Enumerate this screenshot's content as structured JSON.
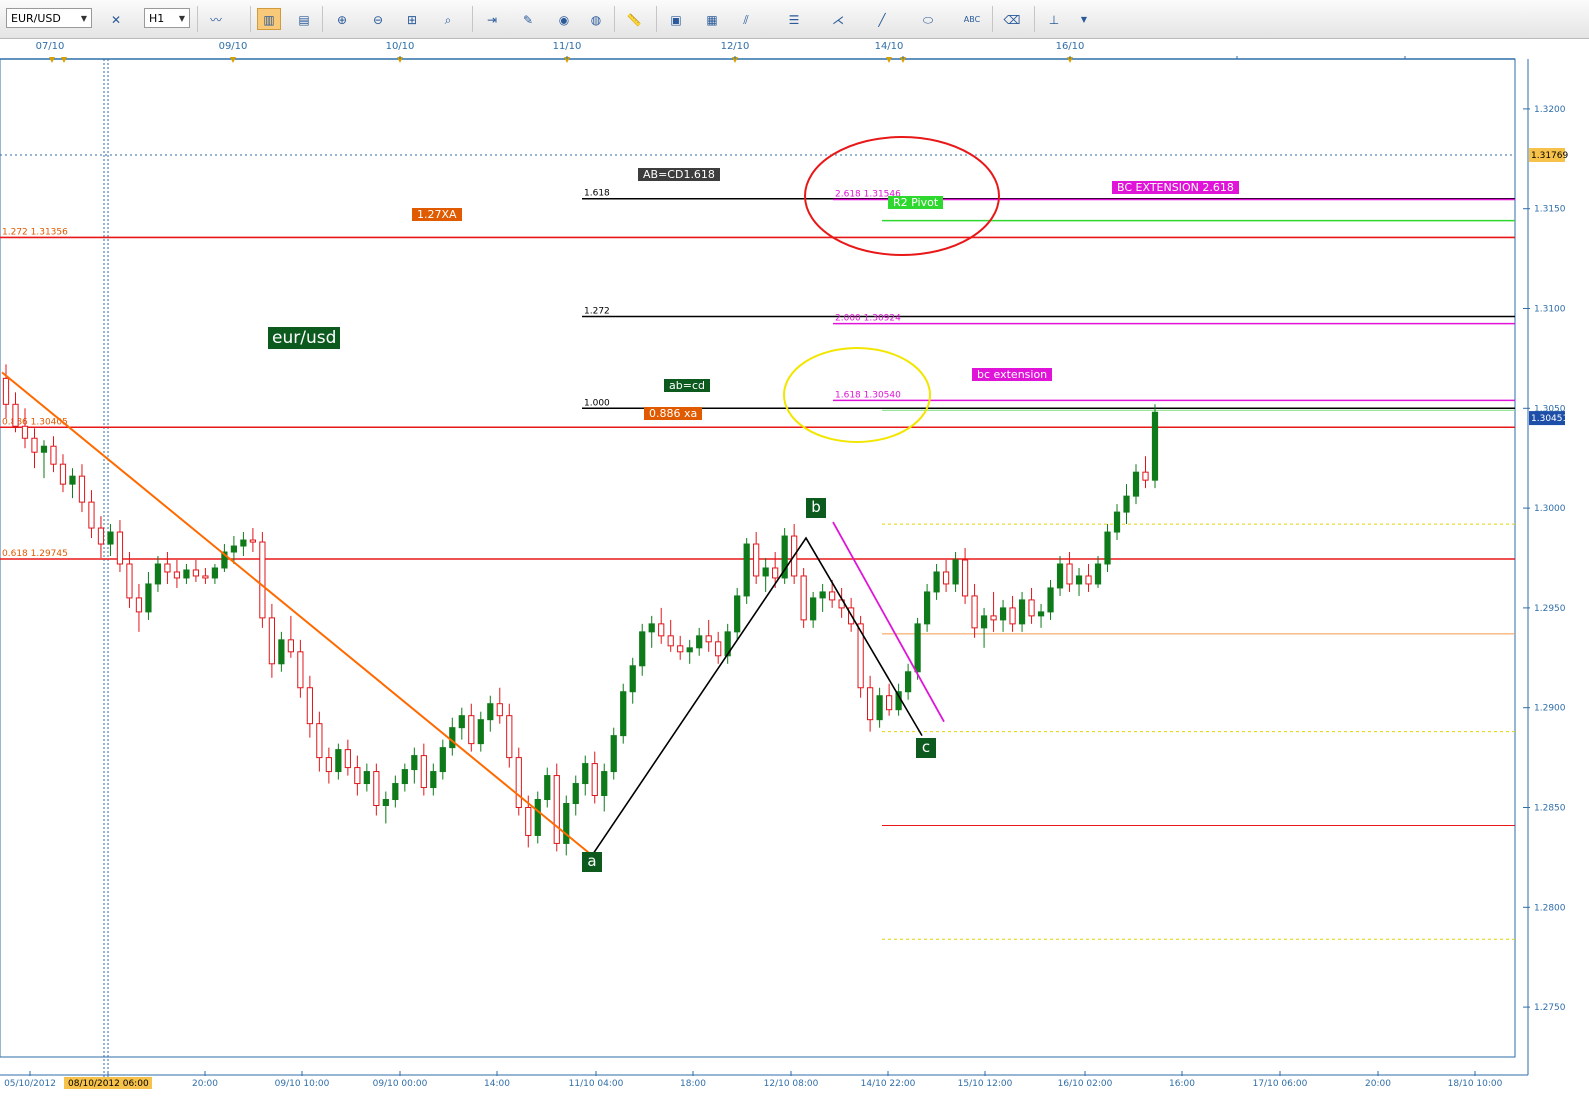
{
  "toolbar": {
    "symbol": "EUR/USD",
    "timeframe": "H1",
    "icons": [
      "chart-type-icon",
      "crosshair-icon",
      "bar-chart-icon",
      "candle-chart-icon",
      "indicator-icon",
      "zoom-in-icon",
      "zoom-out-icon",
      "zoom-fit-icon",
      "period-separator-icon",
      "template-icon",
      "trade-icon",
      "globe-icon",
      "ruler-icon",
      "picture-icon",
      "objects-icon",
      "trendline-icon",
      "hline-icon",
      "pitchfork-icon",
      "line-icon",
      "ellipse-icon",
      "text-icon",
      "eraser-icon",
      "tree-icon"
    ]
  },
  "date_axis": [
    "07/10",
    "09/10",
    "10/10",
    "11/10",
    "12/10",
    "14/10",
    "16/10"
  ],
  "time_axis": [
    "05/10/2012",
    "08/10/2012 06:00",
    "20:00",
    "09/10 10:00",
    "09/10 00:00",
    "14:00",
    "11/10 04:00",
    "18:00",
    "12/10 08:00",
    "14/10 22:00",
    "15/10 12:00",
    "16/10 02:00",
    "16:00",
    "17/10 06:00",
    "20:00",
    "18/10 10:00"
  ],
  "price_axis": [
    "1.3200",
    "1.3150",
    "1.3100",
    "1.3050",
    "1.3000",
    "1.2950",
    "1.2900",
    "1.2850",
    "1.2800",
    "1.2750"
  ],
  "price_markers": {
    "current": "1.30451",
    "dotted": "1.31769"
  },
  "colors": {
    "bull": "#0e7a1a",
    "bear": "#e0151a",
    "axis": "#2f6ea8",
    "fib": "#e05a00",
    "pink": "#e014d8"
  },
  "chart_data": {
    "type": "candlestick",
    "title": "eur/usd",
    "ylim": [
      1.2725,
      1.3225
    ],
    "levels": [
      {
        "price": 1.31769,
        "label": "",
        "style": "dotted-blue"
      },
      {
        "price": 1.3155,
        "label": "1.618",
        "box": "AB=CD1.618",
        "style": "black"
      },
      {
        "price": 1.31546,
        "label": "2.618 1.31546",
        "box": "BC EXTENSION 2.618",
        "style": "pink"
      },
      {
        "price": 1.3144,
        "label": "",
        "box": "R2 Pivot",
        "style": "green"
      },
      {
        "price": 1.31356,
        "label": "1.272 1.31356",
        "box": "1.27XA",
        "style": "red"
      },
      {
        "price": 1.3096,
        "label": "1.272",
        "style": "black"
      },
      {
        "price": 1.30924,
        "label": "2.000 1.30924",
        "style": "pink"
      },
      {
        "price": 1.3054,
        "label": "1.618 1.30540",
        "box": "bc extension",
        "style": "pink"
      },
      {
        "price": 1.305,
        "label": "1.000",
        "box": "ab=cd",
        "style": "black"
      },
      {
        "price": 1.3049,
        "label": "",
        "style": "lightgreen"
      },
      {
        "price": 1.30405,
        "label": "0.886 1.30405",
        "box": "0.886 xa",
        "style": "red"
      },
      {
        "price": 1.2992,
        "label": "",
        "style": "yellow-dotted"
      },
      {
        "price": 1.29745,
        "label": "0.618 1.29745",
        "style": "red"
      },
      {
        "price": 1.2937,
        "label": "",
        "style": "orange-thin"
      },
      {
        "price": 1.2888,
        "label": "",
        "style": "yellow-dotted"
      },
      {
        "price": 1.2841,
        "label": "",
        "style": "red-thin"
      },
      {
        "price": 1.2784,
        "label": "",
        "style": "yellow-dotted"
      }
    ],
    "points": [
      {
        "label": "a",
        "price": 1.2826
      },
      {
        "label": "b",
        "price": 1.2985
      },
      {
        "label": "c",
        "price": 1.2886
      }
    ],
    "pattern": [
      {
        "label": "a",
        "price": 1.2826
      },
      {
        "label": "b",
        "price": 1.2985
      },
      {
        "label": "c",
        "price": 1.2886
      }
    ],
    "annotations": [
      "red circle around 1.3150 targets",
      "yellow circle around 1.3050 targets"
    ],
    "candles": [
      [
        1.3065,
        1.3072,
        1.3045,
        1.3052
      ],
      [
        1.3052,
        1.3058,
        1.3038,
        1.3041
      ],
      [
        1.3041,
        1.305,
        1.303,
        1.3035
      ],
      [
        1.3035,
        1.304,
        1.302,
        1.3028
      ],
      [
        1.3028,
        1.3034,
        1.3015,
        1.3031
      ],
      [
        1.3031,
        1.3036,
        1.3018,
        1.3022
      ],
      [
        1.3022,
        1.3027,
        1.3008,
        1.3012
      ],
      [
        1.3012,
        1.302,
        1.3005,
        1.3016
      ],
      [
        1.3016,
        1.3022,
        1.2998,
        1.3003
      ],
      [
        1.3003,
        1.3009,
        1.2985,
        1.299
      ],
      [
        1.299,
        1.2996,
        1.2975,
        1.2982
      ],
      [
        1.2982,
        1.2992,
        1.2976,
        1.2988
      ],
      [
        1.2988,
        1.2994,
        1.2968,
        1.2972
      ],
      [
        1.2972,
        1.2978,
        1.295,
        1.2955
      ],
      [
        1.2955,
        1.2962,
        1.2938,
        1.2948
      ],
      [
        1.2948,
        1.2968,
        1.2944,
        1.2962
      ],
      [
        1.2962,
        1.2976,
        1.2958,
        1.2972
      ],
      [
        1.2972,
        1.2978,
        1.2962,
        1.2968
      ],
      [
        1.2968,
        1.2974,
        1.296,
        1.2965
      ],
      [
        1.2965,
        1.2972,
        1.2962,
        1.2969
      ],
      [
        1.2969,
        1.2974,
        1.2963,
        1.2966
      ],
      [
        1.2966,
        1.297,
        1.2962,
        1.2965
      ],
      [
        1.2965,
        1.2972,
        1.2962,
        1.297
      ],
      [
        1.297,
        1.2982,
        1.2968,
        1.2978
      ],
      [
        1.2978,
        1.2986,
        1.2972,
        1.2981
      ],
      [
        1.2981,
        1.2988,
        1.2976,
        1.2984
      ],
      [
        1.2984,
        1.299,
        1.2978,
        1.2983
      ],
      [
        1.2983,
        1.2988,
        1.294,
        1.2945
      ],
      [
        1.2945,
        1.2952,
        1.2915,
        1.2922
      ],
      [
        1.2922,
        1.2938,
        1.2918,
        1.2934
      ],
      [
        1.2934,
        1.2946,
        1.2925,
        1.2928
      ],
      [
        1.2928,
        1.2934,
        1.2905,
        1.291
      ],
      [
        1.291,
        1.2916,
        1.2885,
        1.2892
      ],
      [
        1.2892,
        1.2898,
        1.2868,
        1.2875
      ],
      [
        1.2875,
        1.288,
        1.2862,
        1.2868
      ],
      [
        1.2868,
        1.2882,
        1.2864,
        1.2879
      ],
      [
        1.2879,
        1.2884,
        1.2866,
        1.287
      ],
      [
        1.287,
        1.2876,
        1.2856,
        1.2862
      ],
      [
        1.2862,
        1.2872,
        1.2858,
        1.2868
      ],
      [
        1.2868,
        1.2872,
        1.2846,
        1.2851
      ],
      [
        1.2851,
        1.2858,
        1.2842,
        1.2854
      ],
      [
        1.2854,
        1.2866,
        1.285,
        1.2862
      ],
      [
        1.2862,
        1.2872,
        1.2858,
        1.2869
      ],
      [
        1.2869,
        1.288,
        1.2862,
        1.2876
      ],
      [
        1.2876,
        1.2882,
        1.2856,
        1.286
      ],
      [
        1.286,
        1.2872,
        1.2856,
        1.2868
      ],
      [
        1.2868,
        1.2884,
        1.2864,
        1.288
      ],
      [
        1.288,
        1.2895,
        1.2876,
        1.289
      ],
      [
        1.289,
        1.29,
        1.2884,
        1.2896
      ],
      [
        1.2896,
        1.2902,
        1.2878,
        1.2882
      ],
      [
        1.2882,
        1.2898,
        1.2878,
        1.2894
      ],
      [
        1.2894,
        1.2906,
        1.2888,
        1.2902
      ],
      [
        1.2902,
        1.291,
        1.2892,
        1.2896
      ],
      [
        1.2896,
        1.2902,
        1.287,
        1.2875
      ],
      [
        1.2875,
        1.288,
        1.2846,
        1.285
      ],
      [
        1.285,
        1.2856,
        1.283,
        1.2836
      ],
      [
        1.2836,
        1.2858,
        1.2832,
        1.2854
      ],
      [
        1.2854,
        1.287,
        1.285,
        1.2866
      ],
      [
        1.2866,
        1.2872,
        1.2828,
        1.2832
      ],
      [
        1.2832,
        1.2856,
        1.2826,
        1.2852
      ],
      [
        1.2852,
        1.2866,
        1.2846,
        1.2862
      ],
      [
        1.2862,
        1.2876,
        1.2856,
        1.2872
      ],
      [
        1.2872,
        1.2878,
        1.2852,
        1.2856
      ],
      [
        1.2856,
        1.2872,
        1.2848,
        1.2868
      ],
      [
        1.2868,
        1.289,
        1.2864,
        1.2886
      ],
      [
        1.2886,
        1.2912,
        1.2882,
        1.2908
      ],
      [
        1.2908,
        1.2925,
        1.2902,
        1.2921
      ],
      [
        1.2921,
        1.2942,
        1.2916,
        1.2938
      ],
      [
        1.2938,
        1.2946,
        1.293,
        1.2942
      ],
      [
        1.2942,
        1.295,
        1.2932,
        1.2936
      ],
      [
        1.2936,
        1.2944,
        1.2928,
        1.2931
      ],
      [
        1.2931,
        1.2936,
        1.2924,
        1.2928
      ],
      [
        1.2928,
        1.2934,
        1.2922,
        1.293
      ],
      [
        1.293,
        1.294,
        1.2926,
        1.2936
      ],
      [
        1.2936,
        1.2944,
        1.2928,
        1.2933
      ],
      [
        1.2933,
        1.2938,
        1.2922,
        1.2926
      ],
      [
        1.2926,
        1.2942,
        1.2922,
        1.2938
      ],
      [
        1.2938,
        1.296,
        1.2934,
        1.2956
      ],
      [
        1.2956,
        1.2985,
        1.2952,
        1.2982
      ],
      [
        1.2982,
        1.2988,
        1.2962,
        1.2966
      ],
      [
        1.2966,
        1.2975,
        1.2958,
        1.297
      ],
      [
        1.297,
        1.2978,
        1.296,
        1.2965
      ],
      [
        1.2965,
        1.299,
        1.2962,
        1.2986
      ],
      [
        1.2986,
        1.2992,
        1.2962,
        1.2966
      ],
      [
        1.2966,
        1.297,
        1.294,
        1.2944
      ],
      [
        1.2944,
        1.2958,
        1.294,
        1.2955
      ],
      [
        1.2955,
        1.2962,
        1.2948,
        1.2958
      ],
      [
        1.2958,
        1.2964,
        1.295,
        1.2954
      ],
      [
        1.2954,
        1.296,
        1.2945,
        1.295
      ],
      [
        1.295,
        1.2955,
        1.2938,
        1.2942
      ],
      [
        1.2942,
        1.2946,
        1.2905,
        1.291
      ],
      [
        1.291,
        1.2916,
        1.2888,
        1.2894
      ],
      [
        1.2894,
        1.291,
        1.289,
        1.2906
      ],
      [
        1.2906,
        1.2912,
        1.2896,
        1.2899
      ],
      [
        1.2899,
        1.2912,
        1.2896,
        1.2908
      ],
      [
        1.2908,
        1.2922,
        1.2904,
        1.2918
      ],
      [
        1.2918,
        1.2945,
        1.2914,
        1.2942
      ],
      [
        1.2942,
        1.2962,
        1.2938,
        1.2958
      ],
      [
        1.2958,
        1.2972,
        1.2954,
        1.2968
      ],
      [
        1.2968,
        1.2974,
        1.2958,
        1.2962
      ],
      [
        1.2962,
        1.2978,
        1.2958,
        1.2974
      ],
      [
        1.2974,
        1.298,
        1.2952,
        1.2956
      ],
      [
        1.2956,
        1.2962,
        1.2935,
        1.294
      ],
      [
        1.294,
        1.295,
        1.293,
        1.2946
      ],
      [
        1.2946,
        1.2958,
        1.2938,
        1.2944
      ],
      [
        1.2944,
        1.2954,
        1.2938,
        1.295
      ],
      [
        1.295,
        1.2956,
        1.2938,
        1.2942
      ],
      [
        1.2942,
        1.2958,
        1.2938,
        1.2954
      ],
      [
        1.2954,
        1.296,
        1.2942,
        1.2946
      ],
      [
        1.2946,
        1.2952,
        1.294,
        1.2948
      ],
      [
        1.2948,
        1.2964,
        1.2944,
        1.296
      ],
      [
        1.296,
        1.2976,
        1.2956,
        1.2972
      ],
      [
        1.2972,
        1.2978,
        1.2958,
        1.2962
      ],
      [
        1.2962,
        1.297,
        1.2956,
        1.2966
      ],
      [
        1.2966,
        1.2972,
        1.2958,
        1.2962
      ],
      [
        1.2962,
        1.2976,
        1.296,
        1.2972
      ],
      [
        1.2972,
        1.2992,
        1.2968,
        1.2988
      ],
      [
        1.2988,
        1.3002,
        1.2984,
        1.2998
      ],
      [
        1.2998,
        1.3012,
        1.2992,
        1.3006
      ],
      [
        1.3006,
        1.3022,
        1.3002,
        1.3018
      ],
      [
        1.3018,
        1.3026,
        1.301,
        1.3014
      ],
      [
        1.3014,
        1.3052,
        1.301,
        1.3048
      ]
    ]
  }
}
